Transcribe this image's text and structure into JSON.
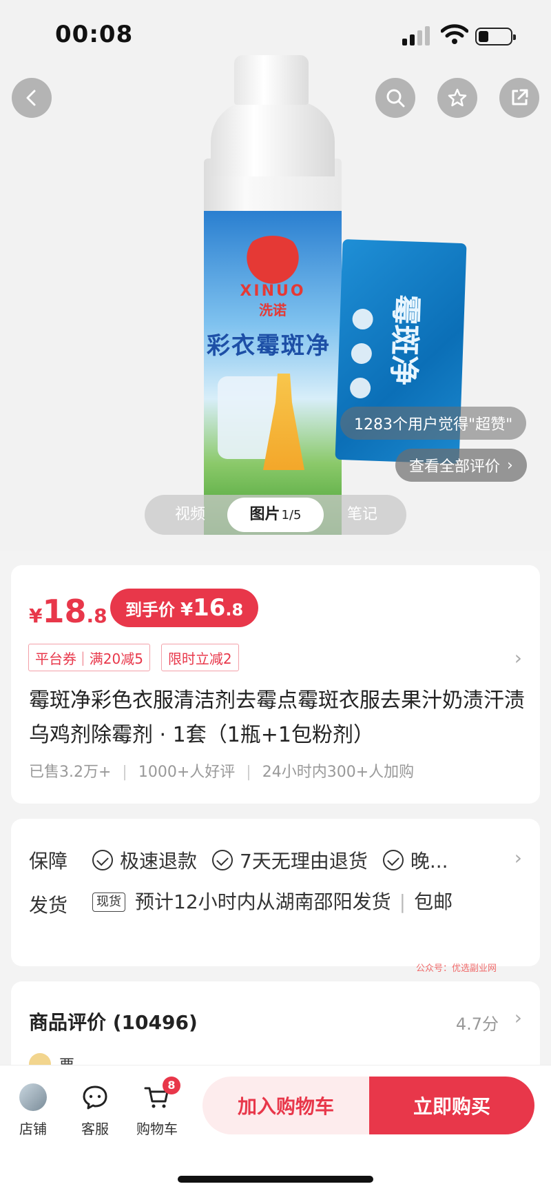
{
  "status_bar": {
    "time": "00:08"
  },
  "hero": {
    "bottle_brand": "XINUO",
    "bottle_brand_cn": "洗诺",
    "bottle_title": "彩衣霉斑净",
    "sachet_title": "霉斑净",
    "praise_text": "1283个用户觉得\"超赞\"",
    "all_reviews_label": "查看全部评价",
    "media_tabs": [
      {
        "label": "视频"
      },
      {
        "label": "图片",
        "count": "1/5"
      },
      {
        "label": "笔记"
      }
    ]
  },
  "price": {
    "currency": "¥",
    "current_int": "18",
    "current_dec": ".8",
    "final_label": "到手价",
    "final_int": "16",
    "final_dec": ".8",
    "coupons": [
      {
        "name": "平台券",
        "detail": "满20减5"
      },
      {
        "name": "限时立减2"
      }
    ]
  },
  "product": {
    "title": "霉斑净彩色衣服清洁剂去霉点霉斑衣服去果汁奶渍汗渍乌鸡剂除霉剂 · 1套（1瓶+1包粉剂）",
    "stats": [
      "已售3.2万+",
      "1000+人好评",
      "24小时内300+人加购"
    ]
  },
  "service": {
    "guarantee_label": "保障",
    "guarantees": [
      "极速退款",
      "7天无理由退货",
      "晚..."
    ],
    "shipping_label": "发货",
    "stock_tag": "现货",
    "shipping_text": "预计12小时内从湖南邵阳发货",
    "shipping_extra": "包邮"
  },
  "watermark": "公众号：优选副业网",
  "reviews": {
    "title": "商品评价 (10496)",
    "score": "4.7分",
    "first_reviewer": "栗"
  },
  "bottom_bar": {
    "store_label": "店铺",
    "service_label": "客服",
    "cart_label": "购物车",
    "cart_count": "8",
    "add_to_cart_label": "加入购物车",
    "buy_now_label": "立即购买"
  },
  "colors": {
    "accent": "#e8374a",
    "accent_light": "#fdeced"
  }
}
